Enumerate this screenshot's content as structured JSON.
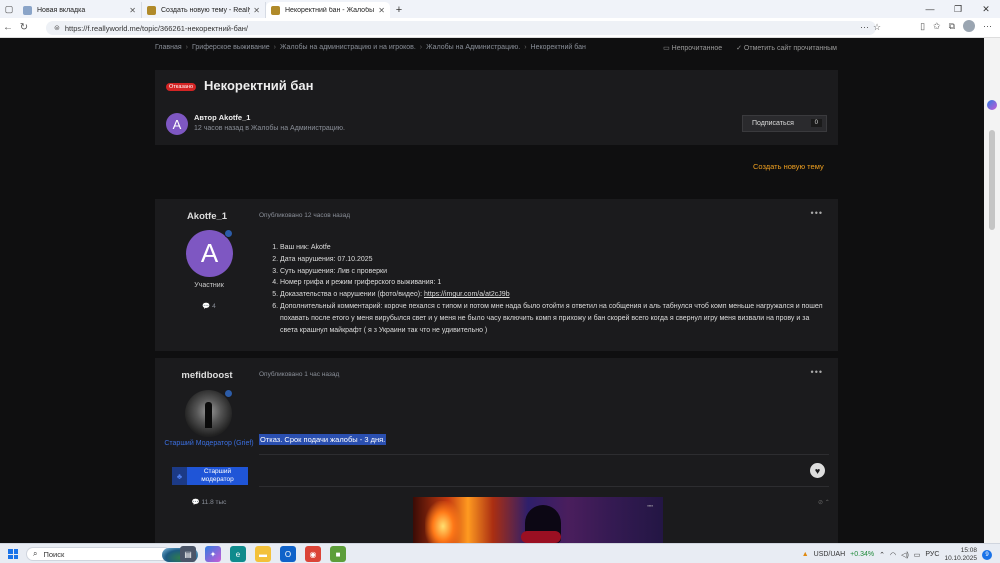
{
  "browser": {
    "tabs": [
      {
        "title": "Новая вкладка",
        "favicon_color": "#8aa4c8"
      },
      {
        "title": "Создать новую тему - ReallyWorld",
        "favicon_color": "#b08a2a"
      },
      {
        "title": "Некоректний бан - Жалобы на а...",
        "favicon_color": "#b08a2a"
      }
    ],
    "url": "https://f.reallyworld.me/topic/366261-некоректний-бан/"
  },
  "breadcrumb": {
    "items": [
      "Главная",
      "Гриферское выживание",
      "Жалобы на администрацию и на игроков.",
      "Жалобы на Администрацию.",
      "Некоректний бан"
    ],
    "unread": "Непрочитанное",
    "mark_read": "Отметить сайт прочитанным"
  },
  "topic": {
    "status_badge": "Отказано",
    "title": "Некоректний бан",
    "author_initial": "A",
    "author_label": "Автор Akotfe_1",
    "meta": "12 часов назад в Жалобы на Администрацию.",
    "subscribe_label": "Подписаться",
    "subscribe_count": "0",
    "create_topic": "Создать новую тему"
  },
  "posts": [
    {
      "username": "Akotfe_1",
      "initial": "A",
      "role": "Участник",
      "post_count": "4",
      "date": "Опубликовано 12 часов назад",
      "more": "•••",
      "items": [
        "Ваш ник: Akotfe",
        "Дата нарушения: 07.10.2025",
        "Суть нарушения: Лив с проверки",
        "Номер грифа и режим гриферского выживания: 1",
        "Доказательства о нарушении (фото/видео):",
        "Дополнительный комментарий: короче пехался с типом и потом мне нада было отойти  я ответил на собщения и аль  табнулся чтоб комп меньше нагружался и пошел похавать после етого у меня вирубылся свет и у меня не было часу включить комп я прихожу и бан скорей всего когда я свернул игру меня визвали на прову и за света  крашнул майкрафт ( я з Украини так что не удивительно )"
      ],
      "proof_link": "https://imgur.com/a/at2cJ9b"
    },
    {
      "username": "mefidboost",
      "role": "Старший Модератор (Grief)",
      "badge": "Старший модератор",
      "post_count": "11.8 тыс",
      "date": "Опубликовано 1 час назад",
      "more": "•••",
      "text": "Отказ. Срок подачи жалобы - 3 дня."
    }
  ],
  "taskbar": {
    "search": "Поиск",
    "currency": "USD/UAH",
    "change": "+0.34%",
    "lang": "РУС",
    "time": "15:08",
    "date": "10.10.2025",
    "notifications": "9"
  }
}
